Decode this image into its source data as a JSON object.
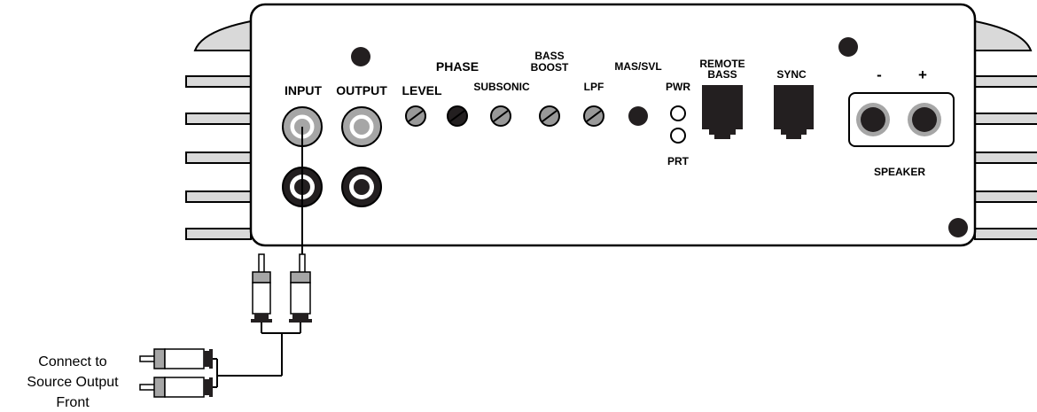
{
  "panel": {
    "labels": {
      "input": "INPUT",
      "output": "OUTPUT",
      "level": "LEVEL",
      "phase": "PHASE",
      "subsonic": "SUBSONIC",
      "bass_boost_1": "BASS",
      "bass_boost_2": "BOOST",
      "lpf": "LPF",
      "mas_svl": "MAS/SVL",
      "pwr": "PWR",
      "prt": "PRT",
      "remote_bass_1": "REMOTE",
      "remote_bass_2": "BASS",
      "sync": "SYNC",
      "minus": "-",
      "plus": "+",
      "speaker": "SPEAKER"
    }
  },
  "caption": {
    "line1": "Connect to",
    "line2": "Source Output",
    "line3": "Front"
  },
  "colors": {
    "outline": "#000000",
    "heatsink": "#d9d9d9",
    "rca_gray": "#a6a6a6",
    "knob": "#999999"
  }
}
